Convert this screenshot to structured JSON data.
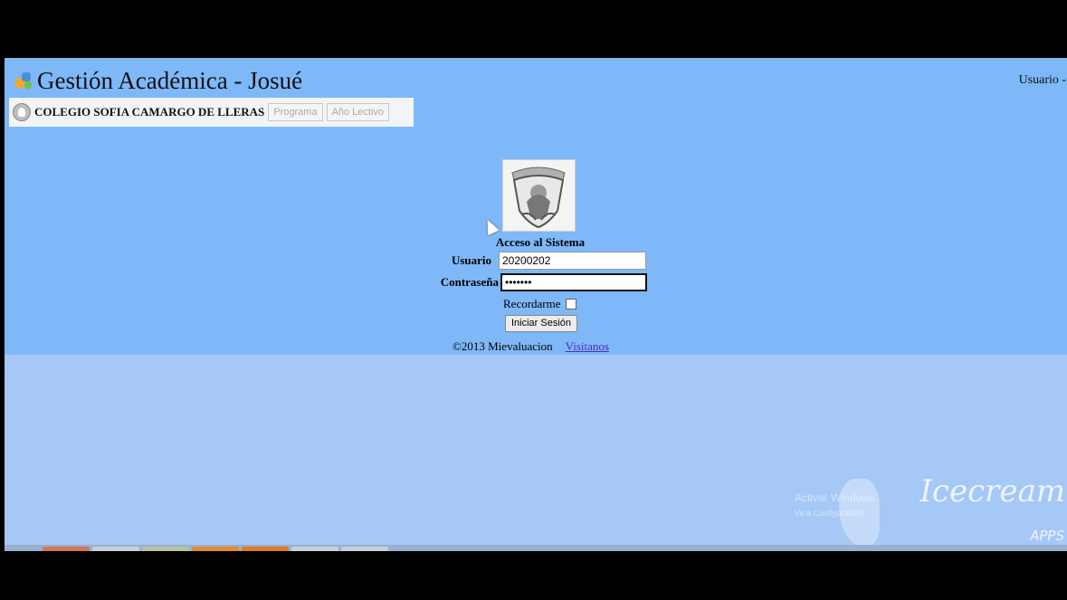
{
  "header": {
    "app_title": "Gestión Académica - Josué",
    "user_label": "Usuario -:"
  },
  "school_bar": {
    "school_name": "COLEGIO SOFIA CAMARGO DE LLERAS",
    "program_button": "Programa",
    "year_button": "Año Lectivo"
  },
  "login": {
    "title": "Acceso al Sistema",
    "user_label": "Usuario",
    "user_value": "20200202",
    "password_label": "Contraseña",
    "password_value": "•••••••",
    "remember_label": "Recordarme",
    "remember_checked": false,
    "submit_label": "Iniciar Sesión"
  },
  "footer": {
    "copyright": "©2013 Mievaluacion",
    "visitors_link": "Visitanos"
  },
  "watermark": {
    "brand": "Icecream",
    "sub": "APPS",
    "activate": "Activar Windows",
    "activate_sub": "Ve a Configuración"
  },
  "colors": {
    "header_band": "#7eb8f8",
    "page_background": "#a6c8f7",
    "link": "#4a30b8"
  }
}
